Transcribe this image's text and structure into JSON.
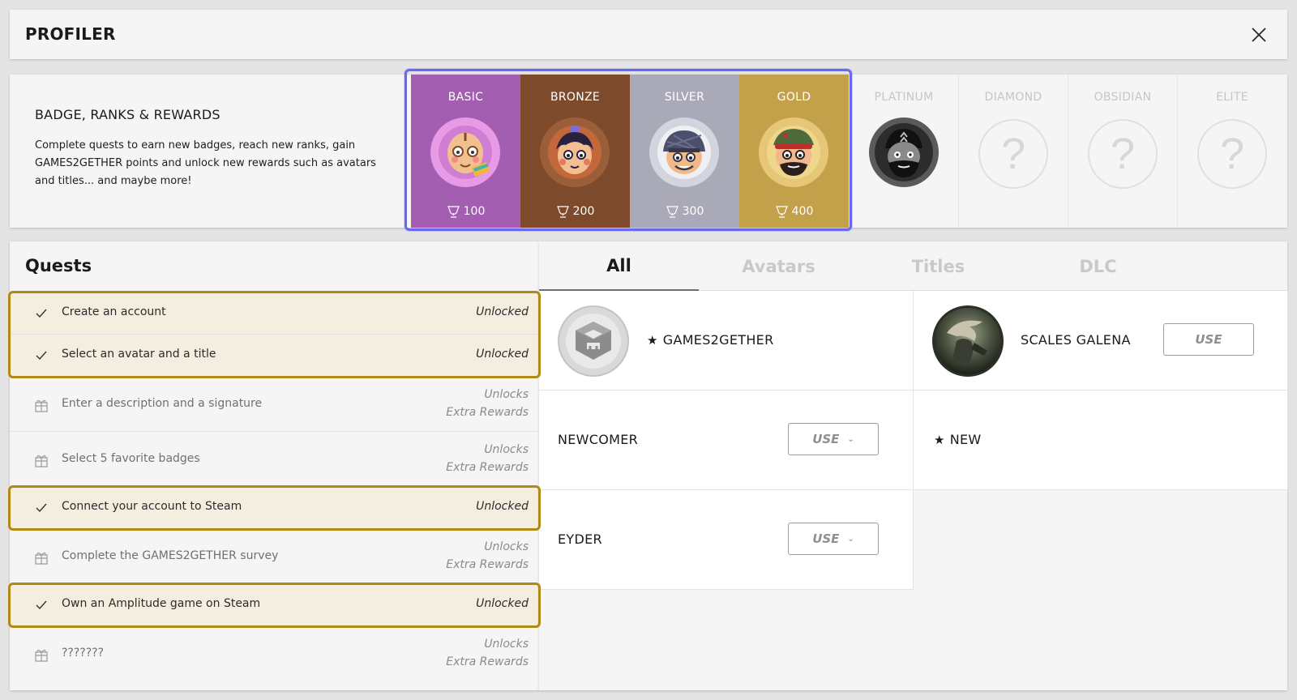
{
  "window": {
    "title": "PROFILER",
    "close_icon": "close-icon"
  },
  "ranks": {
    "heading": "BADGE, RANKS & REWARDS",
    "description": "Complete quests to earn new badges, reach new ranks, gain GAMES2GETHER points and unlock new rewards such as avatars and titles... and maybe more!",
    "tiers": [
      {
        "name": "BASIC",
        "points": "100",
        "color": "#a35eb2",
        "state": "unlocked"
      },
      {
        "name": "BRONZE",
        "points": "200",
        "color": "#7d4a2c",
        "state": "unlocked"
      },
      {
        "name": "SILVER",
        "points": "300",
        "color": "#a9a9b7",
        "state": "unlocked"
      },
      {
        "name": "GOLD",
        "points": "400",
        "color": "#c3a04a",
        "state": "unlocked"
      },
      {
        "name": "PLATINUM",
        "state": "locked"
      },
      {
        "name": "DIAMOND",
        "state": "locked",
        "mark": "?"
      },
      {
        "name": "OBSIDIAN",
        "state": "locked",
        "mark": "?"
      },
      {
        "name": "ELITE",
        "state": "locked",
        "mark": "?"
      }
    ]
  },
  "quests": {
    "title": "Quests",
    "items": [
      {
        "label": "Create an account",
        "status": "Unlocked",
        "state": "done"
      },
      {
        "label": "Select an avatar and a title",
        "status": "Unlocked",
        "state": "done"
      },
      {
        "label": "Enter a description and a signature",
        "status_line1": "Unlocks",
        "status_line2": "Extra Rewards",
        "state": "locked"
      },
      {
        "label": "Select 5 favorite badges",
        "status_line1": "Unlocks",
        "status_line2": "Extra Rewards",
        "state": "locked"
      },
      {
        "label": "Connect your account to Steam",
        "status": "Unlocked",
        "state": "done"
      },
      {
        "label": "Complete the GAMES2GETHER survey",
        "status_line1": "Unlocks",
        "status_line2": "Extra Rewards",
        "state": "locked"
      },
      {
        "label": "Own an Amplitude game on Steam",
        "status": "Unlocked",
        "state": "done"
      },
      {
        "label": "???????",
        "status_line1": "Unlocks",
        "status_line2": "Extra Rewards",
        "state": "locked"
      }
    ]
  },
  "rewards": {
    "tabs": [
      "All",
      "Avatars",
      "Titles",
      "DLC"
    ],
    "active_tab": "All",
    "items": [
      {
        "name": "GAMES2GETHER",
        "starred": true,
        "star": "★"
      },
      {
        "name": "SCALES GALENA",
        "button": "USE"
      },
      {
        "name": "NEWCOMER",
        "button": "USE",
        "chevron": "⌄"
      },
      {
        "name": "NEW",
        "starred": true,
        "star": "★"
      },
      {
        "name": "EYDER",
        "button": "USE",
        "chevron": "⌄"
      }
    ]
  },
  "colors": {
    "tier_highlight": "#6a68f0",
    "quest_highlight": "#b08a14",
    "quest_done_bg": "#f4eee0"
  }
}
